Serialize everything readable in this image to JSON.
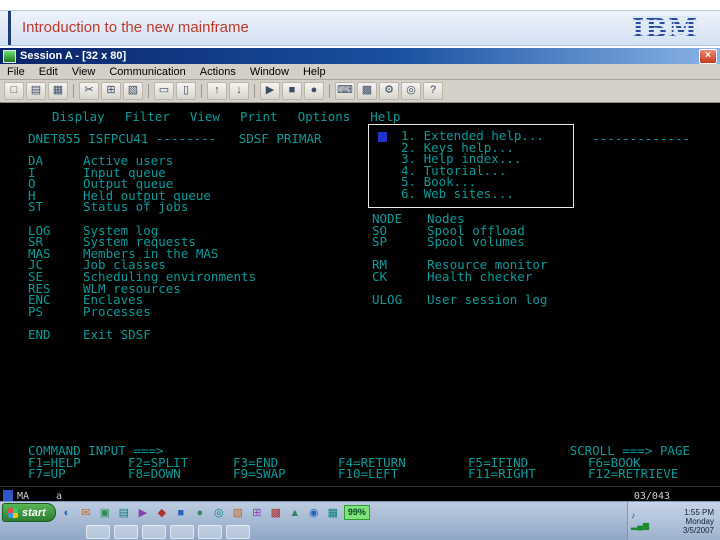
{
  "slide": {
    "title": "Introduction to the new mainframe",
    "title_color": "#c0392b",
    "logo_text": "IBM"
  },
  "window": {
    "title": "Session A - [32 x 80]",
    "close_glyph": "×",
    "menu_items": [
      "File",
      "Edit",
      "View",
      "Communication",
      "Actions",
      "Window",
      "Help"
    ],
    "toolbar_icons": [
      {
        "name": "new-session",
        "glyph": "□"
      },
      {
        "name": "open-file",
        "glyph": "▤"
      },
      {
        "name": "save",
        "glyph": "▦"
      },
      {
        "name": "cut",
        "glyph": "✂"
      },
      {
        "name": "copy",
        "glyph": "⊞"
      },
      {
        "name": "paste",
        "glyph": "▧"
      },
      {
        "name": "print",
        "glyph": "▭"
      },
      {
        "name": "print-screen",
        "glyph": "▯"
      },
      {
        "name": "send-file",
        "glyph": "↑"
      },
      {
        "name": "receive-file",
        "glyph": "↓"
      },
      {
        "name": "play-macro",
        "glyph": "▶"
      },
      {
        "name": "stop-macro",
        "glyph": "■"
      },
      {
        "name": "record-macro",
        "glyph": "●"
      },
      {
        "name": "keyboard-map",
        "glyph": "⌨"
      },
      {
        "name": "color-map",
        "glyph": "▩"
      },
      {
        "name": "settings",
        "glyph": "⚙"
      },
      {
        "name": "zoom",
        "glyph": "◎"
      },
      {
        "name": "help",
        "glyph": "?"
      }
    ]
  },
  "terminal": {
    "fg": "#0a9b9b",
    "bg": "#000000",
    "action_bar": [
      "Display",
      "Filter",
      "View",
      "Print",
      "Options",
      "Help"
    ],
    "header_left": "DNET855 ISFPCU41 --------   SDSF PRIMAR",
    "header_right_dashes": "-------------",
    "dropdown_items": [
      "1. Extended help...",
      "2. Keys help...",
      "3. Help index...",
      "4. Tutorial...",
      "5. Book...",
      "6. Web sites..."
    ],
    "rows": [
      {
        "lc": "DA",
        "ld": "Active users"
      },
      {
        "lc": "I",
        "ld": "Input queue"
      },
      {
        "lc": "O",
        "ld": "Output queue"
      },
      {
        "lc": "H",
        "ld": "Held output queue"
      },
      {
        "lc": "ST",
        "ld": "Status of jobs"
      },
      {
        "rc": "NODE",
        "rd": "Nodes"
      },
      {
        "lc": "LOG",
        "ld": "System log",
        "rc": "SO",
        "rd": "Spool offload"
      },
      {
        "lc": "SR",
        "ld": "System requests",
        "rc": "SP",
        "rd": "Spool volumes"
      },
      {
        "lc": "MAS",
        "ld": "Members in the MAS"
      },
      {
        "lc": "JC",
        "ld": "Job classes",
        "rc": "RM",
        "rd": "Resource monitor"
      },
      {
        "lc": "SE",
        "ld": "Scheduling environments",
        "rc": "CK",
        "rd": "Health checker"
      },
      {
        "lc": "RES",
        "ld": "WLM resources"
      },
      {
        "lc": "ENC",
        "ld": "Enclaves",
        "rc": "ULOG",
        "rd": "User session log"
      },
      {
        "lc": "PS",
        "ld": "Processes"
      },
      {},
      {
        "lc": "END",
        "ld": "Exit SDSF"
      }
    ],
    "command_label": "COMMAND INPUT ===>",
    "scroll_label": "SCROLL ===> PAGE",
    "fkeys_row1": [
      "F1=HELP",
      "F2=SPLIT",
      "F3=END",
      "F4=RETURN",
      "F5=IFIND",
      "F6=BOOK"
    ],
    "fkeys_row2": [
      "F7=UP",
      "F8=DOWN",
      "F9=SWAP",
      "F10=LEFT",
      "F11=RIGHT",
      "F12=RETRIEVE"
    ]
  },
  "oia": {
    "indicator": "MA",
    "session_short": "a",
    "cursor_position": "03/043"
  },
  "taskbar": {
    "start_label": "start",
    "battery": "99%",
    "quicklaunch": [
      {
        "name": "internet",
        "glyph": "◐"
      },
      {
        "name": "email",
        "glyph": "✉"
      },
      {
        "name": "desktop",
        "glyph": "▣"
      },
      {
        "name": "explorer",
        "glyph": "▤"
      },
      {
        "name": "media-player",
        "glyph": "▶"
      },
      {
        "name": "documents",
        "glyph": "◆"
      },
      {
        "name": "terminal",
        "glyph": "■"
      },
      {
        "name": "messenger",
        "glyph": "●"
      },
      {
        "name": "search",
        "glyph": "◎"
      },
      {
        "name": "notes",
        "glyph": "▧"
      },
      {
        "name": "calculator",
        "glyph": "⊞"
      },
      {
        "name": "paint",
        "glyph": "▩"
      },
      {
        "name": "update",
        "glyph": "▲"
      },
      {
        "name": "antivirus",
        "glyph": "◉"
      },
      {
        "name": "network-places",
        "glyph": "▦"
      }
    ],
    "tray_icons": [
      {
        "name": "volume",
        "glyph": "♪"
      },
      {
        "name": "signal",
        "glyph": "▂▄▆"
      }
    ],
    "clock": {
      "time": "1:55 PM",
      "day": "Monday",
      "date": "3/5/2007"
    }
  }
}
